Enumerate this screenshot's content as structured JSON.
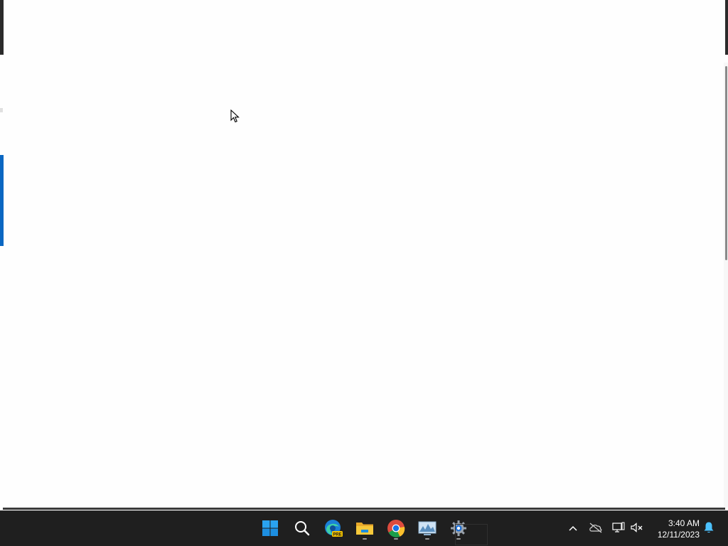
{
  "taskbar": {
    "apps": [
      {
        "name": "start-button",
        "icon": "windows-start-icon"
      },
      {
        "name": "search-button",
        "icon": "search-icon"
      },
      {
        "name": "edge-preview-button",
        "icon": "edge-preview-icon",
        "badge": "PRE"
      },
      {
        "name": "file-explorer-button",
        "icon": "folder-icon"
      },
      {
        "name": "chrome-button",
        "icon": "chrome-icon"
      },
      {
        "name": "performance-monitor-button",
        "icon": "monitor-chart-icon"
      },
      {
        "name": "settings-button",
        "icon": "gear-icon"
      }
    ],
    "tray": {
      "icons": [
        "chevron-up-icon",
        "onedrive-offline-icon",
        "network-icon",
        "volume-muted-icon",
        "notification-bell-icon"
      ],
      "time": "3:40 AM",
      "date": "12/11/2023"
    }
  },
  "colors": {
    "accent": "#0a67c2",
    "taskbar_bg": "#1f1f1f",
    "window_bg": "#fefefe"
  }
}
